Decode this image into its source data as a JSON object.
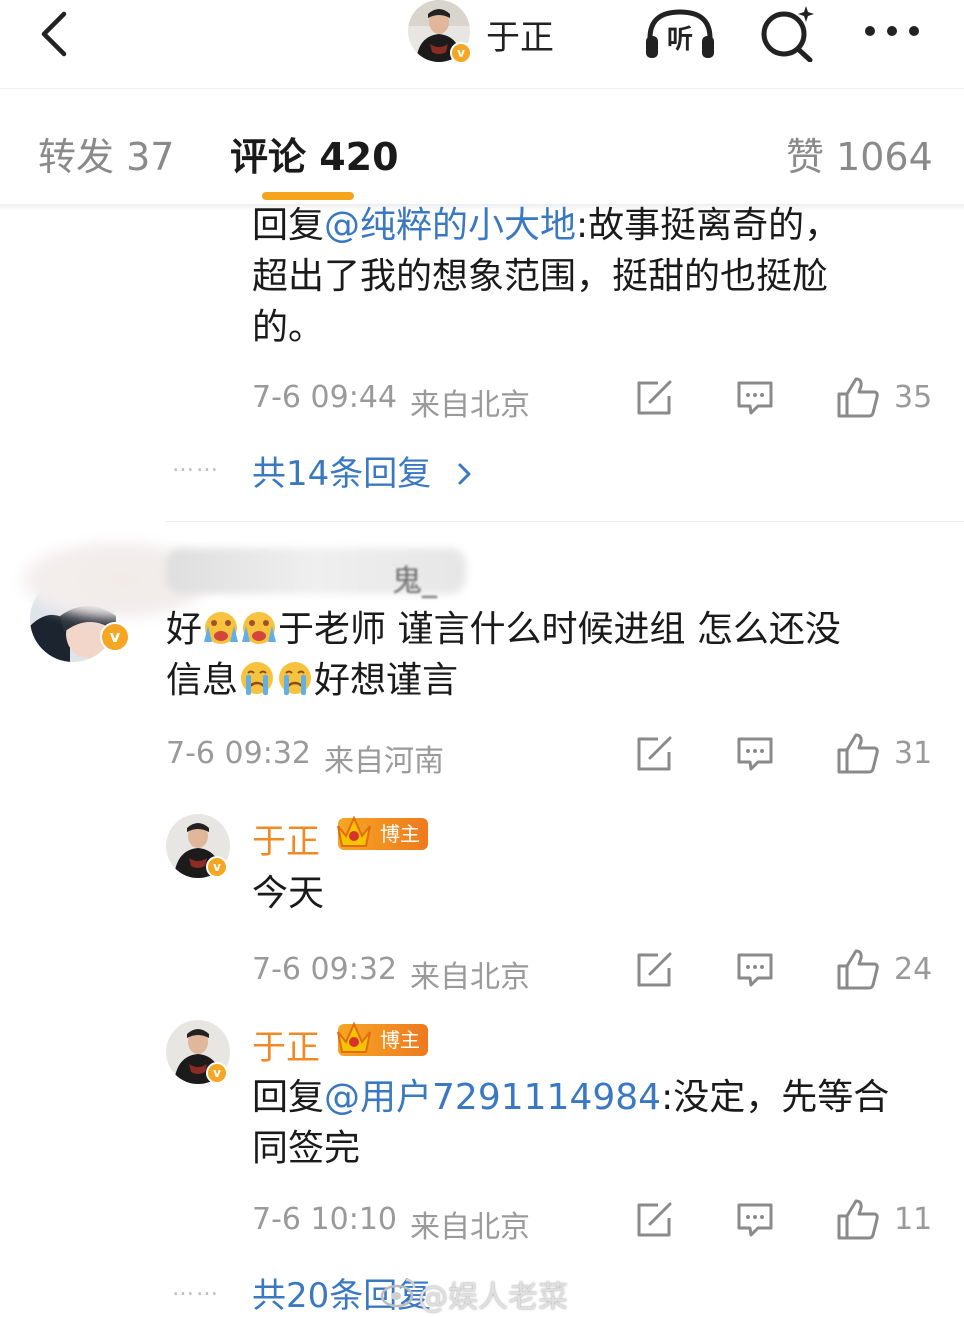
{
  "header": {
    "title": "于正",
    "avatar_badge": "v"
  },
  "tabs": [
    {
      "label": "转发 37"
    },
    {
      "label": "评论 420"
    },
    {
      "label": "赞 1064"
    }
  ],
  "comment1": {
    "reply_prefix": "回复",
    "mention": "@纯粹的小大地",
    "text_line1": ":故事挺离奇的，",
    "text_line2": "超出了我的想象范围，挺甜的也挺尬",
    "text_line3": "的。",
    "date": "7-6 09:44",
    "location": "来自北京",
    "likes": "35",
    "dots": "……",
    "more_replies": "共14条回复"
  },
  "comment2": {
    "name_tail": "鬼_",
    "avatar_badge": "v",
    "text_line1_a": "好",
    "text_line1_b": "于老师 谨言什么时候进组 怎么还没",
    "text_line2_a": "信息",
    "text_line2_b": "好想谨言",
    "date": "7-6 09:32",
    "location": "来自河南",
    "likes": "31"
  },
  "reply1": {
    "name": "于正",
    "tag": "博主",
    "text": "今天",
    "date": "7-6 09:32",
    "location": "来自北京",
    "likes": "24"
  },
  "reply2": {
    "name": "于正",
    "tag": "博主",
    "reply_prefix": "回复",
    "mention": "@用户7291114984",
    "text_line1": ":没定，先等合",
    "text_line2": "同签完",
    "date": "7-6 10:10",
    "location": "来自北京",
    "likes": "11"
  },
  "footer": {
    "dots": "……",
    "more_replies": "共20条回复",
    "watermark": "@娱人老菜"
  },
  "colors": {
    "accent": "#f7a41d",
    "link": "#3a78c2",
    "meta": "#9a9a9a",
    "name_orange": "#f08a24"
  }
}
